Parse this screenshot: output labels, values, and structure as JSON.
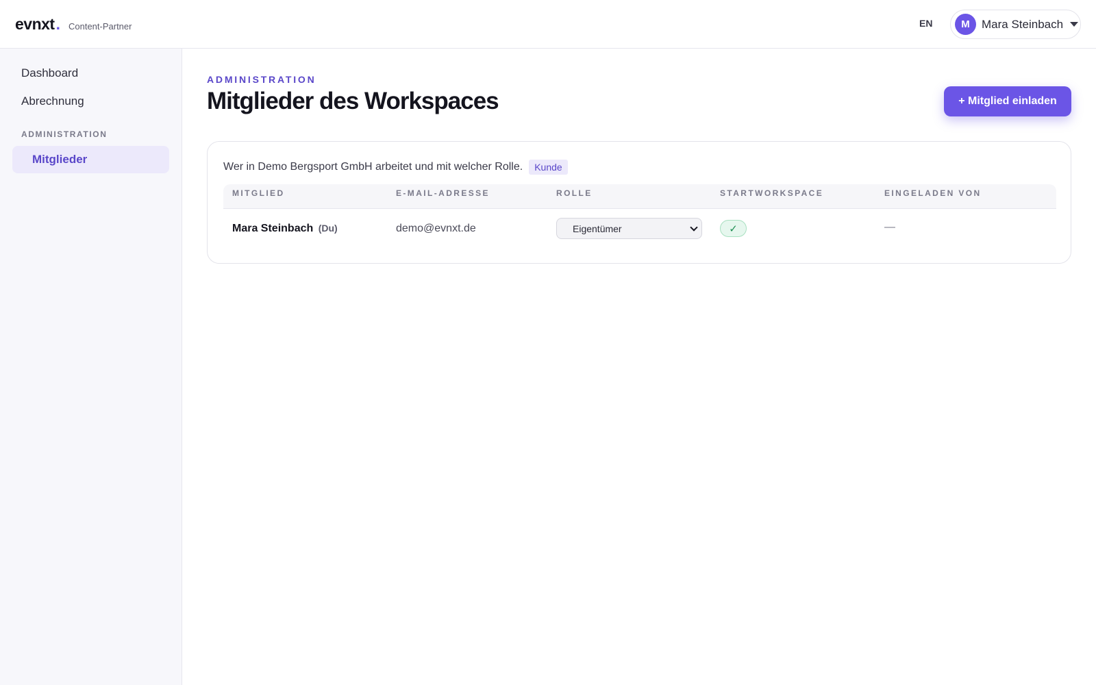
{
  "header": {
    "brand": "evnxt",
    "brand_dot": ".",
    "brand_subtitle": "Content-Partner",
    "language": "EN",
    "user": {
      "initial": "M",
      "name": "Mara Steinbach"
    }
  },
  "sidebar": {
    "items": [
      {
        "label": "Dashboard"
      },
      {
        "label": "Abrechnung"
      }
    ],
    "section_label": "ADMINISTRATION",
    "active_item": "Mitglieder"
  },
  "main": {
    "eyebrow": "ADMINISTRATION",
    "title": "Mitglieder des Workspaces",
    "invite_button": "+ Mitglied einladen",
    "card": {
      "description": "Wer in Demo Bergsport GmbH arbeitet und mit welcher Rolle.",
      "badge": "Kunde",
      "columns": [
        "MITGLIED",
        "E-MAIL-ADRESSE",
        "ROLLE",
        "STARTWORKSPACE",
        "EINGELADEN VON"
      ],
      "rows": [
        {
          "name": "Mara Steinbach",
          "suffix": "(Du)",
          "email": "demo@evnxt.de",
          "role": "Eigentümer",
          "start_workspace": "✓",
          "invited_by": "—"
        }
      ]
    }
  },
  "colors": {
    "accent": "#6b55e6",
    "accent_text": "#5a47c9",
    "accent_soft": "#ece9fb",
    "success_bg": "#e6f7ee",
    "success_text": "#1f8f53"
  }
}
